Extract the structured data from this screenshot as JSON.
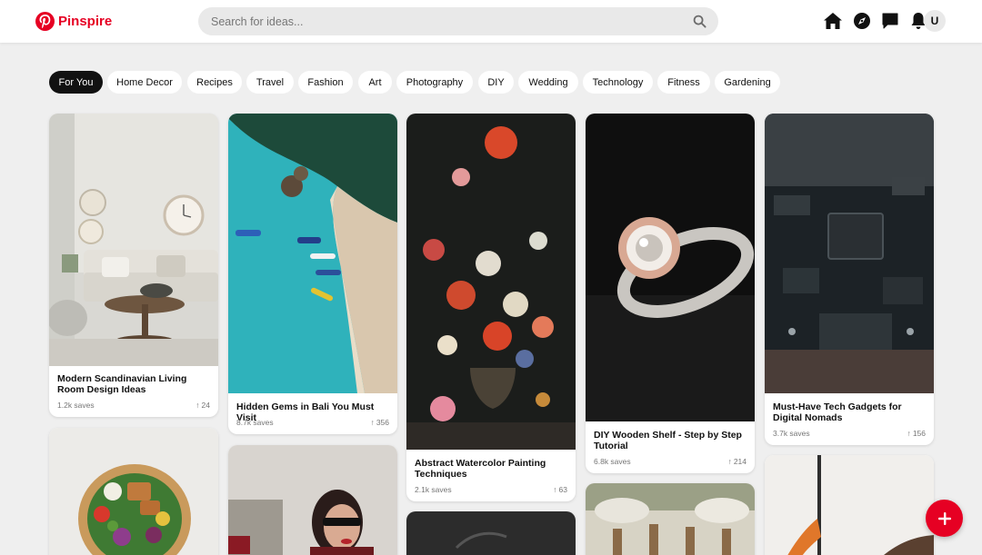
{
  "app": {
    "name": "Pinspire"
  },
  "search": {
    "placeholder": "Search for ideas..."
  },
  "header_icons": [
    "home-icon",
    "compass-icon",
    "chat-icon",
    "bell-icon"
  ],
  "user": {
    "initial": "U"
  },
  "categories": [
    "For You",
    "Home Decor",
    "Recipes",
    "Travel",
    "Fashion",
    "Art",
    "Photography",
    "DIY",
    "Wedding",
    "Technology",
    "Fitness",
    "Gardening"
  ],
  "active_category": "For You",
  "pins": [
    {
      "title": "Modern Scandinavian Living Room Design Ideas",
      "saves": "1.2k saves",
      "votes": "24"
    },
    {
      "title": "Hidden Gems in Bali You Must Visit",
      "saves": "8.7k saves",
      "votes": "356"
    },
    {
      "title": "Abstract Watercolor Painting Techniques",
      "saves": "2.1k saves",
      "votes": "63"
    },
    {
      "title": "DIY Wooden Shelf - Step by Step Tutorial",
      "saves": "6.8k saves",
      "votes": "214"
    },
    {
      "title": "Must-Have Tech Gadgets for Digital Nomads",
      "saves": "3.7k saves",
      "votes": "156"
    }
  ],
  "colors": {
    "brand": "#e60023",
    "background": "#efefef",
    "active_chip": "#111111"
  },
  "fab_icon": "plus-icon"
}
